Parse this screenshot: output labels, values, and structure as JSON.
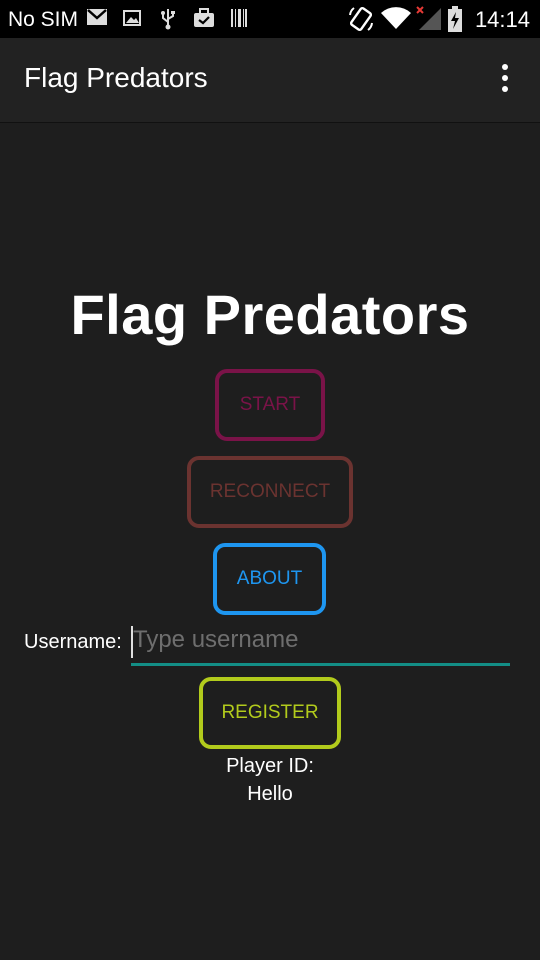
{
  "status_bar": {
    "carrier": "No SIM",
    "time": "14:14",
    "icons": [
      "gmail-icon",
      "image-icon",
      "usb-icon",
      "briefcase-check-icon",
      "barcode-icon",
      "rotate-icon",
      "wifi-icon",
      "signal-icon",
      "battery-charging-icon"
    ]
  },
  "action_bar": {
    "title": "Flag Predators",
    "overflow_icon": "more-vertical-icon"
  },
  "main": {
    "title": "Flag Predators",
    "start_label": "START",
    "reconnect_label": "RECONNECT",
    "about_label": "ABOUT",
    "username_label": "Username:",
    "username_placeholder": "Type username",
    "username_value": "",
    "register_label": "REGISTER",
    "player_id_label": "Player ID:",
    "player_id_value": "Hello"
  },
  "colors": {
    "start": "#7a1348",
    "reconnect": "#6b3330",
    "about": "#1e96f0",
    "register": "#b2cb1c",
    "input_underline": "#138e86",
    "background": "#1e1e1e"
  }
}
